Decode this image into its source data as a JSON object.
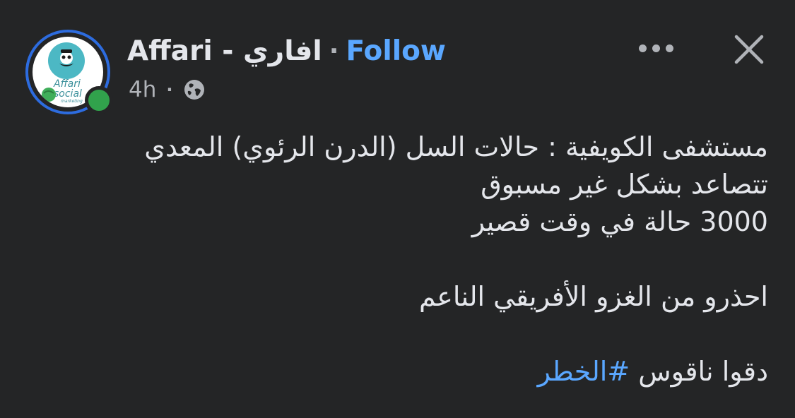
{
  "post": {
    "page_name": "Affari - افاري",
    "separator": "·",
    "follow_label": "Follow",
    "time_ago": "4h",
    "meta_separator": "·",
    "privacy_icon": "globe-icon",
    "more_icon": "more-options-icon",
    "close_icon": "close-icon",
    "avatar": {
      "brand_line1": "Affari",
      "brand_line2": "social",
      "brand_line3": "marketing",
      "ring_color": "#2d6cdf",
      "status_color": "#31a24c"
    },
    "body": {
      "line1": "مستشفى الكويفية : حالات السل (الدرن الرئوي) المعدي",
      "line2": "تتصاعد بشكل غير مسبوق",
      "line3": "3000 حالة في وقت قصير",
      "line4": "احذرو من الغزو الأفريقي الناعم",
      "line5_text": "دقوا ناقوس ",
      "line5_hashtag": "#الخطر"
    }
  },
  "colors": {
    "background": "#242526",
    "text": "#e4e6eb",
    "secondary_text": "#b0b3b8",
    "link": "#5aa7ff"
  }
}
